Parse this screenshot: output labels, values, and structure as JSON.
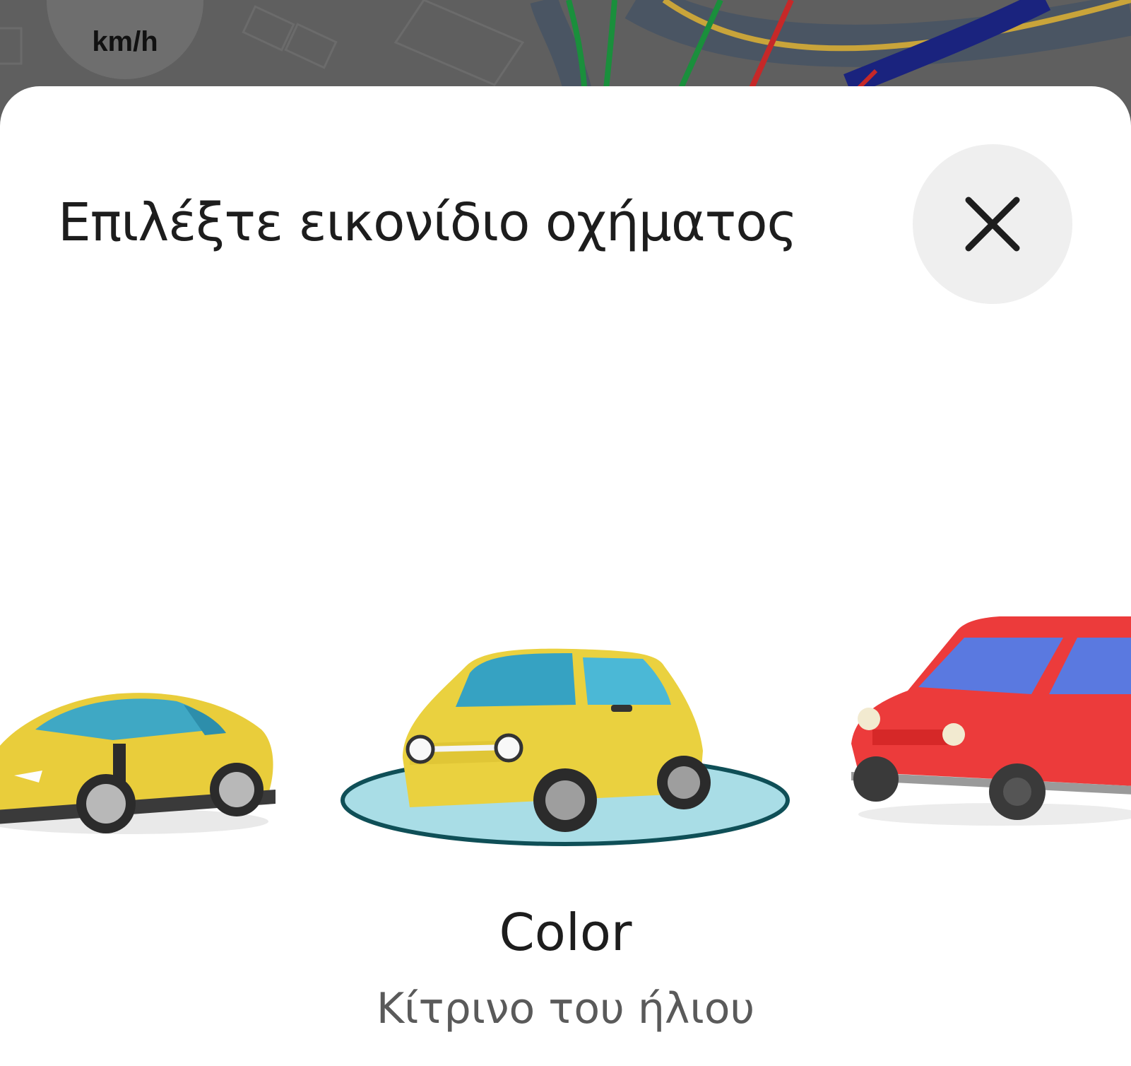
{
  "map": {
    "speed_unit": "km/h",
    "road_colors": {
      "traffic_green": "#1a8f3c",
      "traffic_red": "#c62828",
      "traffic_yellow": "#c9a43a",
      "route_blue": "#1a237e"
    }
  },
  "dialog": {
    "title": "Επιλέξτε εικονίδιο οχήματος",
    "close_icon": "close-icon"
  },
  "carousel": {
    "selected_index": 1,
    "selection_ring_color": "#a9dde6",
    "options": [
      {
        "icon": "sports-car-icon",
        "body_color": "#e9cd3b"
      },
      {
        "icon": "compact-car-icon",
        "body_color": "#ead13f"
      },
      {
        "icon": "hatchback-car-icon",
        "body_color": "#ec3b3b"
      }
    ]
  },
  "vehicle": {
    "name": "Color",
    "color_label": "Κίτρινο του ήλιου"
  }
}
